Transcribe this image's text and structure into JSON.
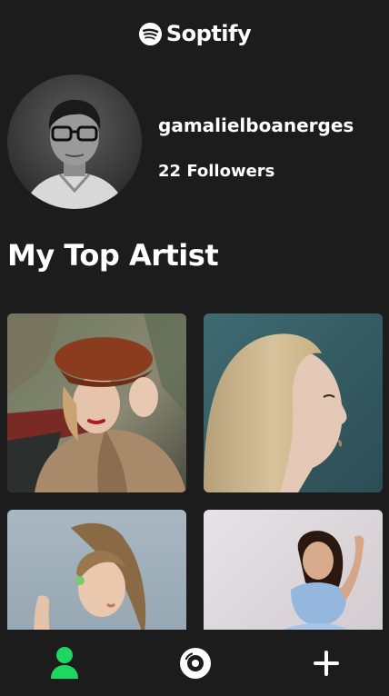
{
  "app": {
    "name": "Soptify",
    "brand_color": "#1ed760",
    "background_color": "#1c1c1c"
  },
  "profile": {
    "username": "gamalielboanerges",
    "followers_text": "22 Followers"
  },
  "section": {
    "title": "My Top Artist"
  },
  "artists": [
    {
      "image": "artist-photo-woman-red-beret"
    },
    {
      "image": "artist-photo-woman-blonde-profile"
    },
    {
      "image": "artist-photo-woman-ponytail-green"
    },
    {
      "image": "artist-photo-woman-denim-outfit"
    }
  ],
  "nav": {
    "items": [
      {
        "icon": "user-icon",
        "active": true
      },
      {
        "icon": "disc-icon",
        "active": false
      },
      {
        "icon": "plus-icon",
        "active": false
      }
    ]
  }
}
